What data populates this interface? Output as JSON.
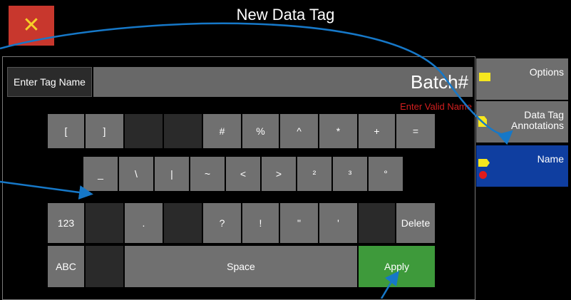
{
  "header": {
    "title": "New Data Tag",
    "close_glyph": "✕"
  },
  "tag_entry": {
    "label": "Enter Tag Name",
    "value": "Batch#",
    "error": "Enter Valid Name"
  },
  "keyboard": {
    "row1": [
      "[",
      "]",
      "",
      "",
      "#",
      "%",
      "^",
      "*",
      "+",
      "="
    ],
    "row2": [
      "_",
      "\\",
      "|",
      "~",
      "<",
      ">",
      "²",
      "³",
      "°"
    ],
    "row3": [
      "123",
      "",
      ".",
      "",
      "?",
      "!",
      "\"",
      "'",
      "",
      "Delete"
    ],
    "row4": {
      "abc": "ABC",
      "blank": "",
      "space": "Space",
      "apply": "Apply"
    }
  },
  "sidebar": {
    "items": [
      {
        "label": "Options",
        "icon": "comment-icon"
      },
      {
        "label": "Data Tag Annotations",
        "icon": "document-icon"
      },
      {
        "label": "Name",
        "icon": "tag-icon",
        "active": true
      }
    ]
  },
  "colors": {
    "close": "#c8372d",
    "apply": "#3e9a3b",
    "active_nav": "#0f3ea0",
    "error": "#d41f1f",
    "callout": "#1678c8",
    "icon": "#f5e61f"
  }
}
